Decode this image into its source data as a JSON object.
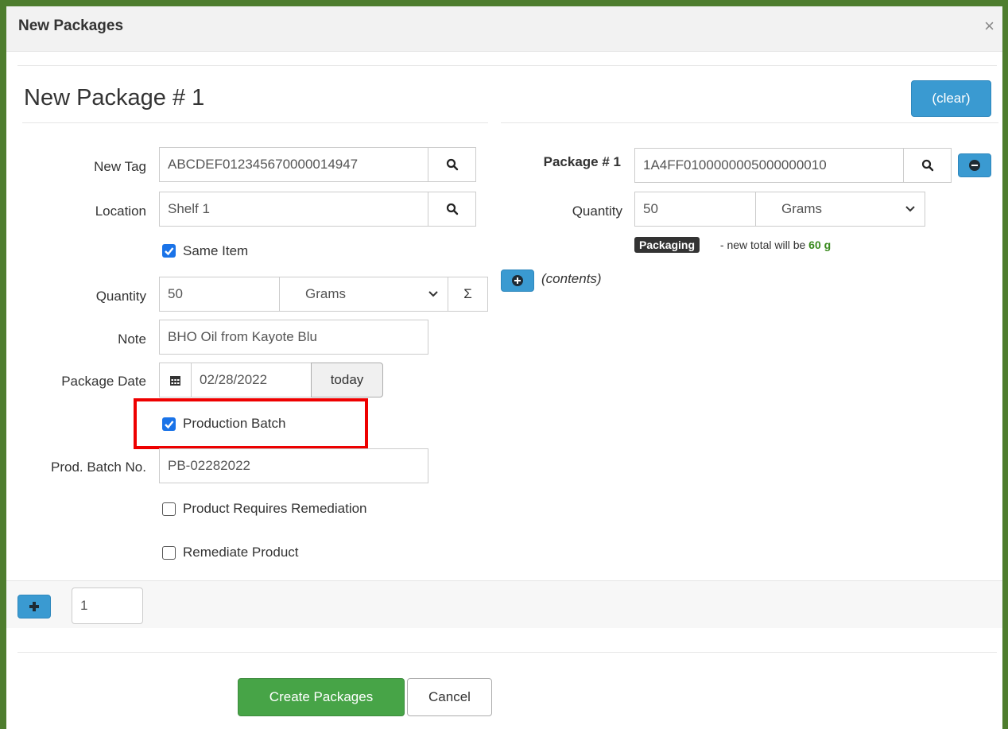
{
  "dialog": {
    "title": "New Packages",
    "close_glyph": "×"
  },
  "package": {
    "heading": "New Package # 1",
    "clear_label": "(clear)"
  },
  "form": {
    "new_tag": {
      "label": "New Tag",
      "value": "ABCDEF012345670000014947"
    },
    "location": {
      "label": "Location",
      "value": "Shelf 1"
    },
    "same_item": {
      "label": "Same Item",
      "checked": true
    },
    "quantity": {
      "label": "Quantity",
      "value": "50",
      "unit": "Grams",
      "sum_glyph": "Σ"
    },
    "note": {
      "label": "Note",
      "value": "BHO Oil from Kayote Blu"
    },
    "package_date": {
      "label": "Package Date",
      "value": "02/28/2022",
      "today_label": "today"
    },
    "production_batch": {
      "label": "Production Batch",
      "checked": true
    },
    "prod_batch_no": {
      "label": "Prod. Batch No.",
      "value": "PB-02282022"
    },
    "requires_remediation": {
      "label": "Product Requires Remediation",
      "checked": false
    },
    "remediate_product": {
      "label": "Remediate Product",
      "checked": false
    }
  },
  "source_package": {
    "label": "Package # 1",
    "tag": "1A4FF0100000005000000010",
    "quantity_label": "Quantity",
    "quantity_value": "50",
    "unit": "Grams",
    "badge": "Packaging",
    "hint_prefix": " - new total will be ",
    "hint_total": "60 g",
    "contents_label": "(contents)"
  },
  "add_row": {
    "count": "1"
  },
  "footer": {
    "create_label": "Create Packages",
    "cancel_label": "Cancel"
  },
  "colors": {
    "frame": "#4e7d2e",
    "info": "#3a9ad1",
    "success": "#47a447",
    "highlight": "#e00000"
  }
}
